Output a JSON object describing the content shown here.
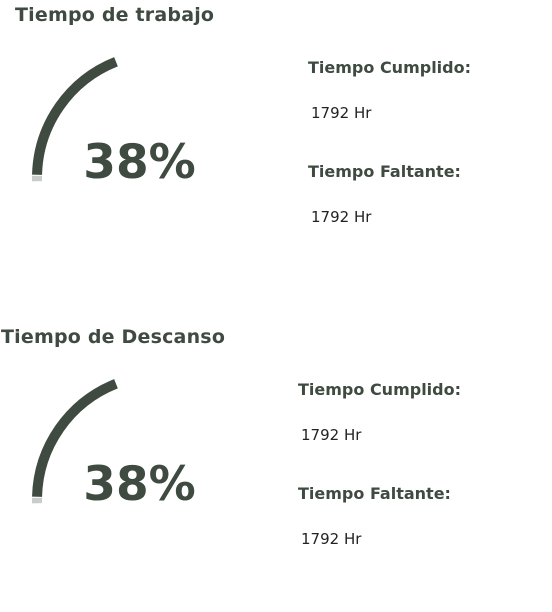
{
  "colors": {
    "accent": "#3f4a40",
    "track": "#c9cdc9",
    "text": "#222222"
  },
  "work": {
    "title": "Tiempo de trabajo",
    "gauge_percent": 38,
    "gauge_label": "38%",
    "completed_label": "Tiempo Cumplido:",
    "completed_value": "1792 Hr",
    "remaining_label": "Tiempo Faltante:",
    "remaining_value": "1792 Hr"
  },
  "rest": {
    "title": "Tiempo de Descanso",
    "gauge_percent": 38,
    "gauge_label": "38%",
    "completed_label": "Tiempo Cumplido:",
    "completed_value": "1792 Hr",
    "remaining_label": "Tiempo Faltante:",
    "remaining_value": "1792 Hr"
  }
}
